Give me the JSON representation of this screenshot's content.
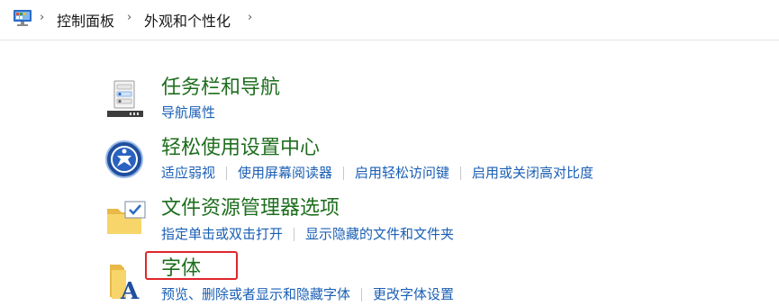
{
  "breadcrumb": {
    "icon": "control-panel-icon",
    "items": [
      "控制面板",
      "外观和个性化"
    ]
  },
  "items": [
    {
      "title": "任务栏和导航",
      "icon": "taskbar-icon",
      "links": [
        "导航属性"
      ]
    },
    {
      "title": "轻松使用设置中心",
      "icon": "ease-of-access-icon",
      "links": [
        "适应弱视",
        "使用屏幕阅读器",
        "启用轻松访问键",
        "启用或关闭高对比度"
      ]
    },
    {
      "title": "文件资源管理器选项",
      "icon": "folder-options-icon",
      "links": [
        "指定单击或双击打开",
        "显示隐藏的文件和文件夹"
      ]
    },
    {
      "title": "字体",
      "icon": "fonts-icon",
      "links": [
        "预览、删除或者显示和隐藏字体",
        "更改字体设置"
      ]
    }
  ],
  "colors": {
    "title": "#1e6e1e",
    "link": "#1a5fb4",
    "highlight": "#e0262a"
  }
}
